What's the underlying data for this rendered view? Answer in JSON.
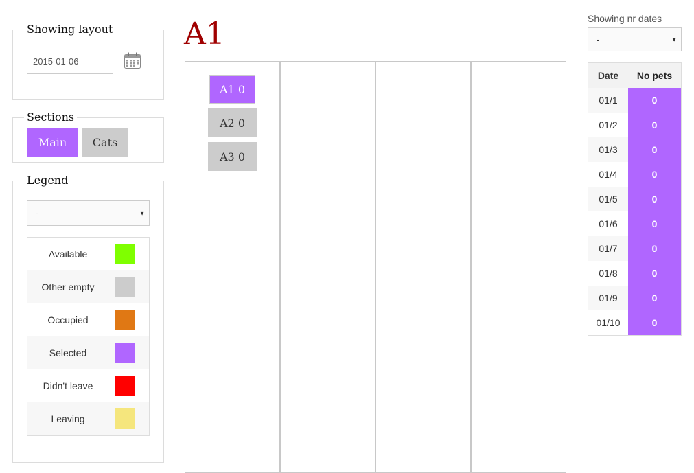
{
  "layout_panel": {
    "title": "Showing layout",
    "date_value": "2015-01-06"
  },
  "sections_panel": {
    "title": "Sections",
    "buttons": [
      {
        "label": "Main",
        "selected": true
      },
      {
        "label": "Cats",
        "selected": false
      }
    ]
  },
  "legend_panel": {
    "title": "Legend",
    "select_value": "-",
    "items": [
      {
        "label": "Available",
        "color": "#7fff00"
      },
      {
        "label": "Other empty",
        "color": "#cccccc"
      },
      {
        "label": "Occupied",
        "color": "#e07814"
      },
      {
        "label": "Selected",
        "color": "#b066ff"
      },
      {
        "label": "Didn't leave",
        "color": "#ff0000"
      },
      {
        "label": "Leaving",
        "color": "#f5e67d"
      }
    ]
  },
  "main": {
    "title": "A1",
    "pens": [
      {
        "label": "A1 0",
        "state": "selected"
      },
      {
        "label": "A2 0",
        "state": "empty"
      },
      {
        "label": "A3 0",
        "state": "empty"
      }
    ]
  },
  "dates_panel": {
    "label": "Showing nr dates",
    "select_value": "-",
    "headers": [
      "Date",
      "No pets"
    ],
    "rows": [
      {
        "date": "01/1",
        "value": "0"
      },
      {
        "date": "01/2",
        "value": "0"
      },
      {
        "date": "01/3",
        "value": "0"
      },
      {
        "date": "01/4",
        "value": "0"
      },
      {
        "date": "01/5",
        "value": "0"
      },
      {
        "date": "01/6",
        "value": "0"
      },
      {
        "date": "01/7",
        "value": "0"
      },
      {
        "date": "01/8",
        "value": "0"
      },
      {
        "date": "01/9",
        "value": "0"
      },
      {
        "date": "01/10",
        "value": "0"
      }
    ]
  },
  "colors": {
    "accent": "#b066ff",
    "title": "#a00000",
    "neutral": "#cccccc"
  },
  "icons": {
    "calendar": "calendar-icon",
    "caret": "caret-down-icon"
  }
}
